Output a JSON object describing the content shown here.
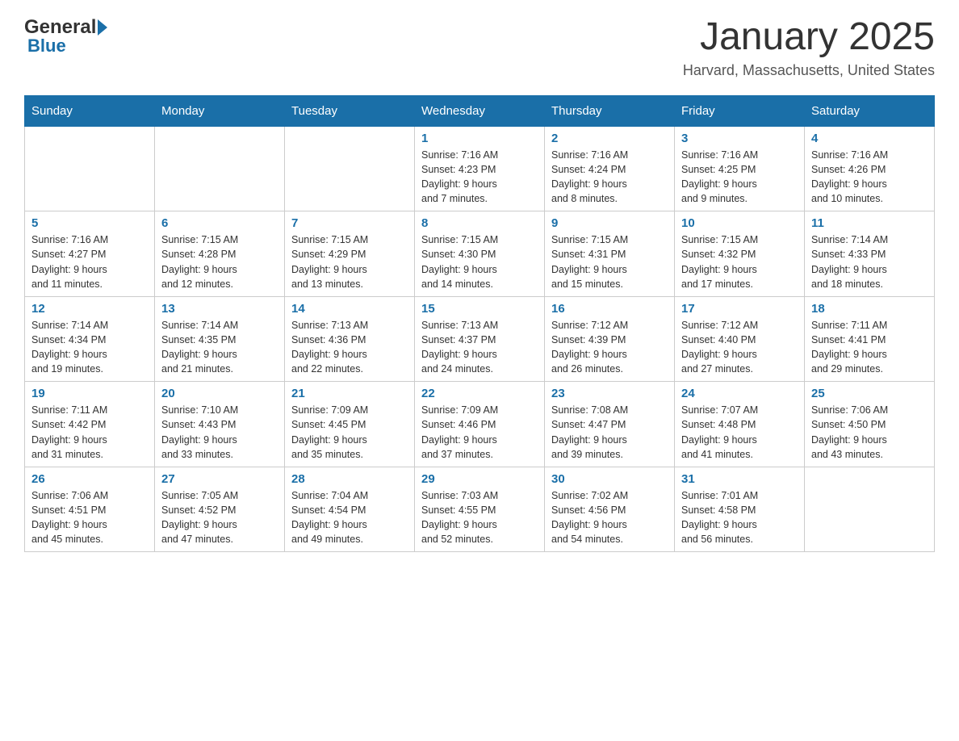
{
  "header": {
    "logo_general": "General",
    "logo_blue": "Blue",
    "month_title": "January 2025",
    "location": "Harvard, Massachusetts, United States"
  },
  "days_of_week": [
    "Sunday",
    "Monday",
    "Tuesday",
    "Wednesday",
    "Thursday",
    "Friday",
    "Saturday"
  ],
  "weeks": [
    [
      {
        "day": "",
        "info": ""
      },
      {
        "day": "",
        "info": ""
      },
      {
        "day": "",
        "info": ""
      },
      {
        "day": "1",
        "info": "Sunrise: 7:16 AM\nSunset: 4:23 PM\nDaylight: 9 hours\nand 7 minutes."
      },
      {
        "day": "2",
        "info": "Sunrise: 7:16 AM\nSunset: 4:24 PM\nDaylight: 9 hours\nand 8 minutes."
      },
      {
        "day": "3",
        "info": "Sunrise: 7:16 AM\nSunset: 4:25 PM\nDaylight: 9 hours\nand 9 minutes."
      },
      {
        "day": "4",
        "info": "Sunrise: 7:16 AM\nSunset: 4:26 PM\nDaylight: 9 hours\nand 10 minutes."
      }
    ],
    [
      {
        "day": "5",
        "info": "Sunrise: 7:16 AM\nSunset: 4:27 PM\nDaylight: 9 hours\nand 11 minutes."
      },
      {
        "day": "6",
        "info": "Sunrise: 7:15 AM\nSunset: 4:28 PM\nDaylight: 9 hours\nand 12 minutes."
      },
      {
        "day": "7",
        "info": "Sunrise: 7:15 AM\nSunset: 4:29 PM\nDaylight: 9 hours\nand 13 minutes."
      },
      {
        "day": "8",
        "info": "Sunrise: 7:15 AM\nSunset: 4:30 PM\nDaylight: 9 hours\nand 14 minutes."
      },
      {
        "day": "9",
        "info": "Sunrise: 7:15 AM\nSunset: 4:31 PM\nDaylight: 9 hours\nand 15 minutes."
      },
      {
        "day": "10",
        "info": "Sunrise: 7:15 AM\nSunset: 4:32 PM\nDaylight: 9 hours\nand 17 minutes."
      },
      {
        "day": "11",
        "info": "Sunrise: 7:14 AM\nSunset: 4:33 PM\nDaylight: 9 hours\nand 18 minutes."
      }
    ],
    [
      {
        "day": "12",
        "info": "Sunrise: 7:14 AM\nSunset: 4:34 PM\nDaylight: 9 hours\nand 19 minutes."
      },
      {
        "day": "13",
        "info": "Sunrise: 7:14 AM\nSunset: 4:35 PM\nDaylight: 9 hours\nand 21 minutes."
      },
      {
        "day": "14",
        "info": "Sunrise: 7:13 AM\nSunset: 4:36 PM\nDaylight: 9 hours\nand 22 minutes."
      },
      {
        "day": "15",
        "info": "Sunrise: 7:13 AM\nSunset: 4:37 PM\nDaylight: 9 hours\nand 24 minutes."
      },
      {
        "day": "16",
        "info": "Sunrise: 7:12 AM\nSunset: 4:39 PM\nDaylight: 9 hours\nand 26 minutes."
      },
      {
        "day": "17",
        "info": "Sunrise: 7:12 AM\nSunset: 4:40 PM\nDaylight: 9 hours\nand 27 minutes."
      },
      {
        "day": "18",
        "info": "Sunrise: 7:11 AM\nSunset: 4:41 PM\nDaylight: 9 hours\nand 29 minutes."
      }
    ],
    [
      {
        "day": "19",
        "info": "Sunrise: 7:11 AM\nSunset: 4:42 PM\nDaylight: 9 hours\nand 31 minutes."
      },
      {
        "day": "20",
        "info": "Sunrise: 7:10 AM\nSunset: 4:43 PM\nDaylight: 9 hours\nand 33 minutes."
      },
      {
        "day": "21",
        "info": "Sunrise: 7:09 AM\nSunset: 4:45 PM\nDaylight: 9 hours\nand 35 minutes."
      },
      {
        "day": "22",
        "info": "Sunrise: 7:09 AM\nSunset: 4:46 PM\nDaylight: 9 hours\nand 37 minutes."
      },
      {
        "day": "23",
        "info": "Sunrise: 7:08 AM\nSunset: 4:47 PM\nDaylight: 9 hours\nand 39 minutes."
      },
      {
        "day": "24",
        "info": "Sunrise: 7:07 AM\nSunset: 4:48 PM\nDaylight: 9 hours\nand 41 minutes."
      },
      {
        "day": "25",
        "info": "Sunrise: 7:06 AM\nSunset: 4:50 PM\nDaylight: 9 hours\nand 43 minutes."
      }
    ],
    [
      {
        "day": "26",
        "info": "Sunrise: 7:06 AM\nSunset: 4:51 PM\nDaylight: 9 hours\nand 45 minutes."
      },
      {
        "day": "27",
        "info": "Sunrise: 7:05 AM\nSunset: 4:52 PM\nDaylight: 9 hours\nand 47 minutes."
      },
      {
        "day": "28",
        "info": "Sunrise: 7:04 AM\nSunset: 4:54 PM\nDaylight: 9 hours\nand 49 minutes."
      },
      {
        "day": "29",
        "info": "Sunrise: 7:03 AM\nSunset: 4:55 PM\nDaylight: 9 hours\nand 52 minutes."
      },
      {
        "day": "30",
        "info": "Sunrise: 7:02 AM\nSunset: 4:56 PM\nDaylight: 9 hours\nand 54 minutes."
      },
      {
        "day": "31",
        "info": "Sunrise: 7:01 AM\nSunset: 4:58 PM\nDaylight: 9 hours\nand 56 minutes."
      },
      {
        "day": "",
        "info": ""
      }
    ]
  ]
}
